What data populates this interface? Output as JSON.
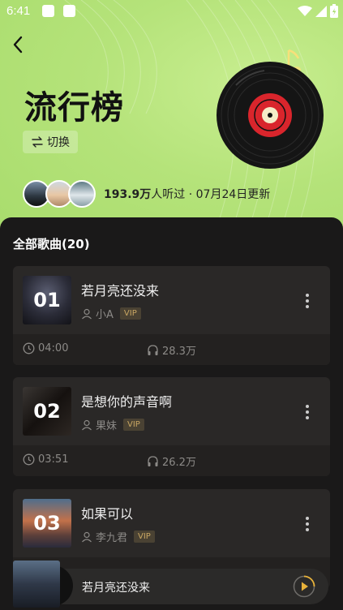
{
  "status": {
    "time": "6:41"
  },
  "header": {
    "title": "流行榜",
    "switch_label": "切换",
    "listen_count": "193.9万",
    "listen_suffix": "人听过 · 07月24日更新"
  },
  "section": {
    "title": "全部歌曲(20)"
  },
  "songs": [
    {
      "rank": "01",
      "name": "若月亮还没来",
      "artist": "小A",
      "badge": "VIP",
      "duration": "04:00",
      "plays": "28.3万"
    },
    {
      "rank": "02",
      "name": "是想你的声音啊",
      "artist": "果妹",
      "badge": "VIP",
      "duration": "03:51",
      "plays": "26.2万"
    },
    {
      "rank": "03",
      "name": "如果可以",
      "artist": "李九君",
      "badge": "VIP",
      "duration": "",
      "plays": ""
    }
  ],
  "player": {
    "title": "若月亮还没来"
  },
  "colors": {
    "hero_green": "#b5e37a",
    "vip_gold": "#c9a763",
    "panel_bg": "#1a1919"
  }
}
